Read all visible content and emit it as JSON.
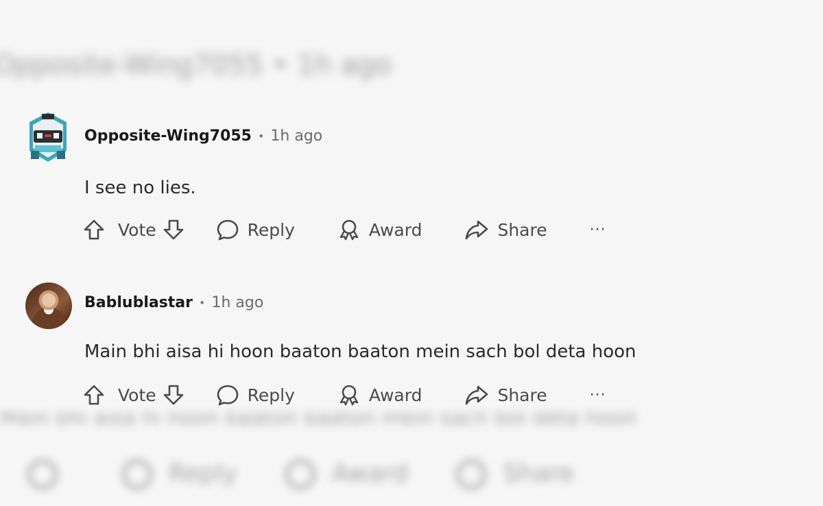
{
  "blurred_header": {
    "text": "Opposite-Wing7055 • 1h ago"
  },
  "comments": [
    {
      "username": "Opposite-Wing7055",
      "separator": "•",
      "time": "1h ago",
      "body": "I see no lies.",
      "actions": {
        "vote": "Vote",
        "reply": "Reply",
        "award": "Award",
        "share": "Share",
        "more": "···"
      }
    },
    {
      "username": "Bablublastar",
      "separator": "•",
      "time": "1h ago",
      "body": "Main bhi aisa hi hoon baaton baaton mein sach bol deta hoon",
      "actions": {
        "vote": "Vote",
        "reply": "Reply",
        "award": "Award",
        "share": "Share",
        "more": "···"
      }
    }
  ],
  "blurred_footer": {
    "text": "Main bhi aisa hi hoon baaton baaton mein sach bol deta hoon",
    "reply": "Reply",
    "award": "Award",
    "share": "Share"
  }
}
